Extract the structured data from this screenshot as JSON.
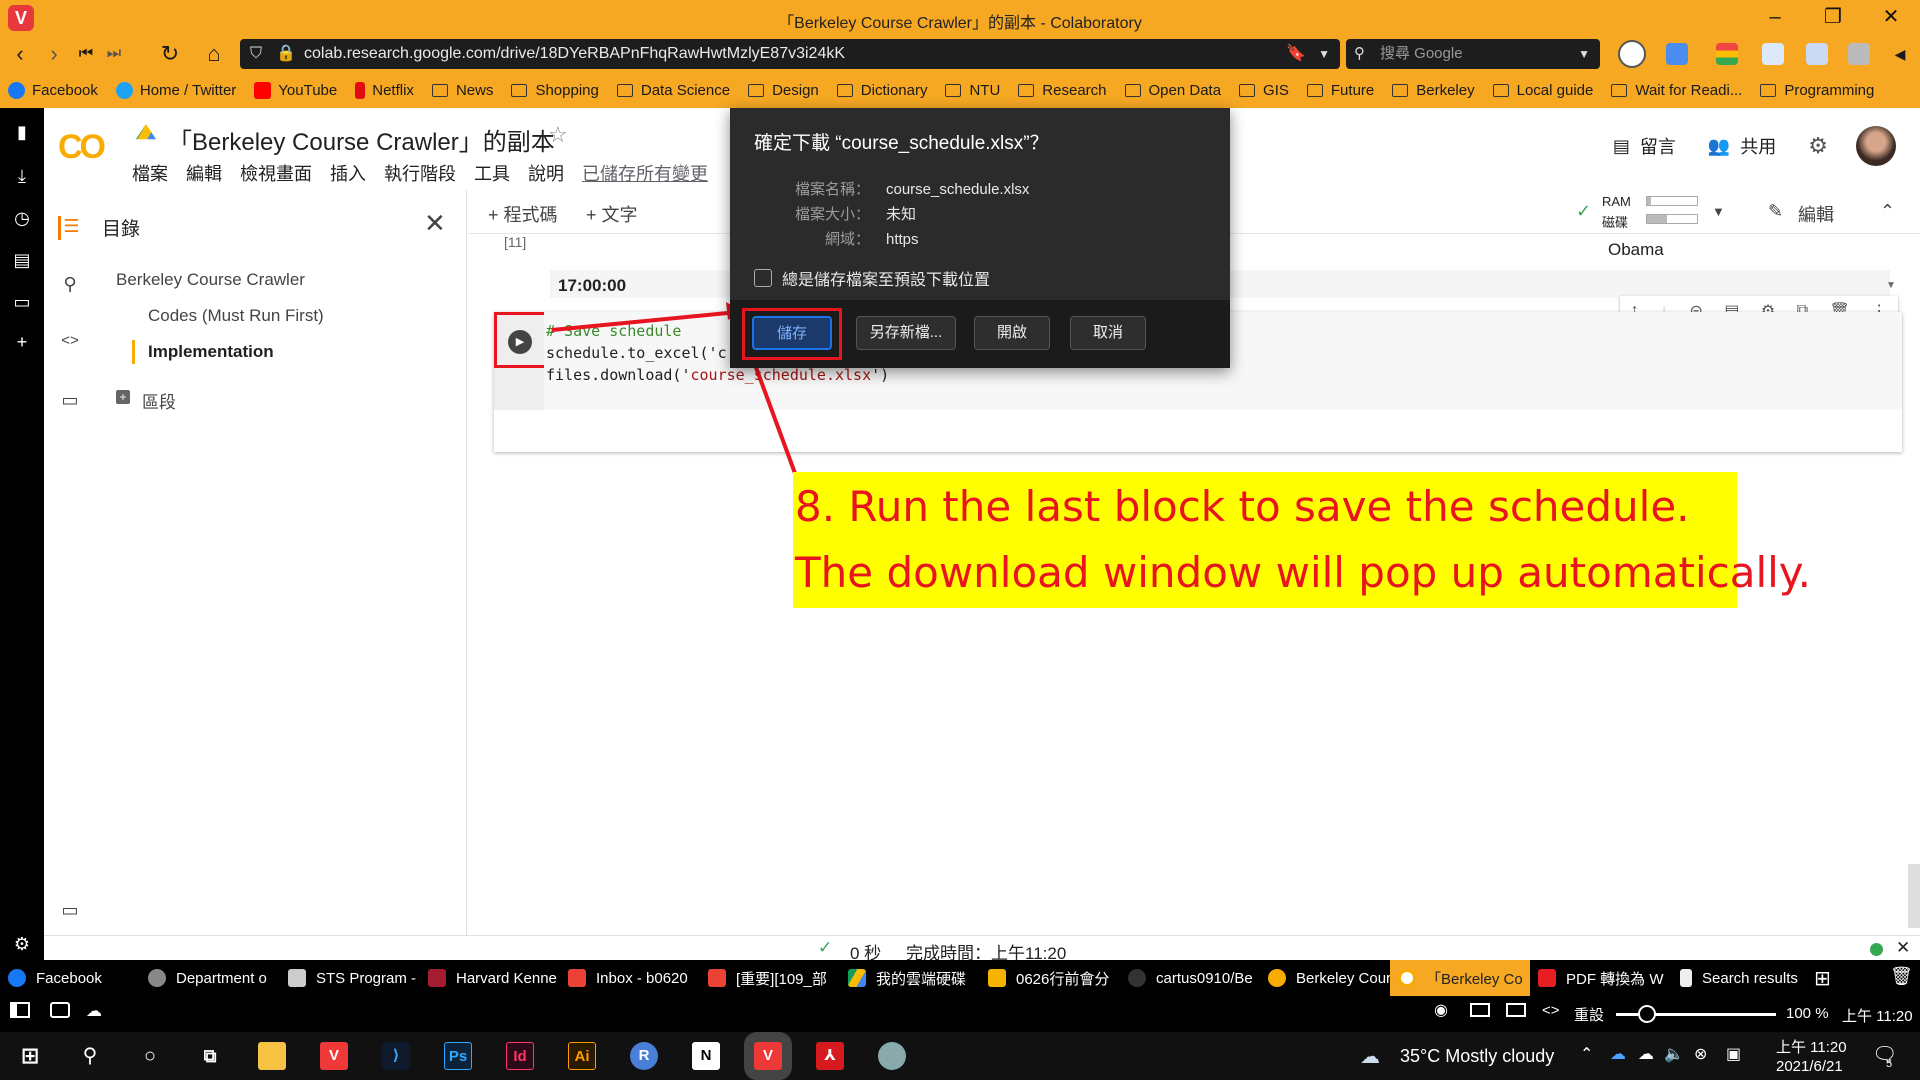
{
  "window_title": "「Berkeley Course Crawler」的副本 - Colaboratory",
  "url": "colab.research.google.com/drive/18DYeRBAPnFhqRawHwtMzlyE87v3i24kK",
  "search_placeholder": "搜尋 Google",
  "bookmarks": [
    "Facebook",
    "Home / Twitter",
    "YouTube",
    "Netflix",
    "News",
    "Shopping",
    "Data Science",
    "Design",
    "Dictionary",
    "NTU",
    "Research",
    "Open Data",
    "GIS",
    "Future",
    "Berkeley",
    "Local guide",
    "Wait for Readi...",
    "Programming"
  ],
  "colab": {
    "logo": "CO",
    "title": "「Berkeley Course Crawler」的副本",
    "menu": [
      "檔案",
      "編輯",
      "檢視畫面",
      "插入",
      "執行階段",
      "工具",
      "說明"
    ],
    "saved_status": "已儲存所有變更",
    "comment": "留言",
    "share": "共用",
    "add_code": "+ 程式碼",
    "add_text": "+ 文字",
    "ram": "RAM",
    "disk": "磁碟",
    "edit": "編輯"
  },
  "toc": {
    "heading": "目錄",
    "items": [
      "Berkeley Course Crawler",
      "Codes (Must Run First)",
      "Implementation"
    ],
    "section": "區段"
  },
  "output": {
    "cell_num": "[11]",
    "time_value": "17:00:00",
    "obama": "Obama"
  },
  "code": {
    "line1": "# Save schedule",
    "line2": "schedule.to_excel('c",
    "line3a": "files.download('",
    "line3b": "course_schedule.xlsx",
    "line3c": "')"
  },
  "dialog": {
    "title": "確定下載 “course_schedule.xlsx”？",
    "filename_label": "檔案名稱：",
    "filename": "course_schedule.xlsx",
    "size_label": "檔案大小：",
    "size": "未知",
    "domain_label": "網域：",
    "domain": "https",
    "checkbox": "總是儲存檔案至預設下載位置",
    "save": "儲存",
    "save_as": "另存新檔...",
    "open": "開啟",
    "cancel": "取消"
  },
  "annotation": {
    "line1": "8. Run the last block to save the schedule.",
    "line2": "The download window will pop up automatically."
  },
  "status": {
    "check": "✓",
    "elapsed": "0 秒",
    "completed": "完成時間：上午11:20"
  },
  "tabs": [
    "Facebook",
    "Department o",
    "STS Program -",
    "Harvard Kenne",
    "Inbox - b0620",
    "[重要][109_部",
    "我的雲端硬碟",
    "0626行前會分",
    "cartus0910/Be",
    "Berkeley Cour",
    "「Berkeley Co",
    "PDF 轉換為 W",
    "Search results"
  ],
  "vivaldi_status": {
    "reset": "重設",
    "zoom": "100 %",
    "time": "上午 11:20"
  },
  "taskbar": {
    "weather": "35°C  Mostly cloudy",
    "time": "上午 11:20",
    "date": "2021/6/21",
    "notif": "5"
  },
  "colors": {
    "vivaldi_orange": "#f6a823",
    "annotation_red": "#e8141f",
    "annotation_bg": "#ffff00",
    "dialog_bg": "#2b2b2b",
    "save_blue": "#1a73e8"
  }
}
